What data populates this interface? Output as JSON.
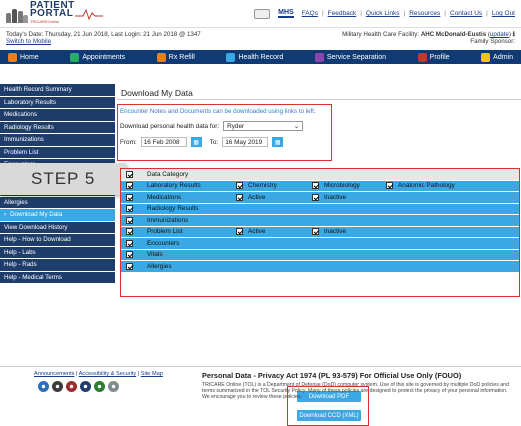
{
  "header": {
    "logo_line1": "PATIENT",
    "logo_line2": "PORTAL",
    "logo_sub": "TRICAREOnline",
    "mhs_label": "MHS",
    "links": [
      "FAQs",
      "Feedback",
      "Quick Links",
      "Resources",
      "Contact Us",
      "Log Out"
    ]
  },
  "info": {
    "date_text": "Today's Date: Thursday, 21 Jun 2018, Last Login: 21 Jun 2018 @ 1347",
    "mobile_link": "Switch to Mobile",
    "facility_label": "Military Health Care Facility: ",
    "facility_name": "AHC McDonald-Eustis",
    "update_link": "update",
    "sponsor_label": "Family Sponsor:"
  },
  "nav": {
    "items": [
      {
        "label": "Home",
        "icon": "home-icon",
        "color": "#e67e22"
      },
      {
        "label": "Appointments",
        "icon": "calendar-icon",
        "color": "#27ae60"
      },
      {
        "label": "Rx Refill",
        "icon": "pill-icon",
        "color": "#e67e22"
      },
      {
        "label": "Health Record",
        "icon": "health-record-icon",
        "color": "#3aa8e3"
      },
      {
        "label": "Service Separation",
        "icon": "service-separation-icon",
        "color": "#8e44ad"
      },
      {
        "label": "Profile",
        "icon": "profile-icon",
        "color": "#c0392b"
      },
      {
        "label": "Admin",
        "icon": "admin-icon",
        "color": "#f1c40f"
      }
    ]
  },
  "sidebar": {
    "items": [
      "Health Record Summary",
      "Laboratory Results",
      "Medications",
      "Radiology Results",
      "Immunizations",
      "Problem List",
      "Encounters",
      "Documents",
      "Vitals",
      "Allergies",
      "Download My Data",
      "View Download History",
      "Help - How to Download",
      "Help - Labs",
      "Help - Rads",
      "Help - Medical Terms"
    ],
    "active_index": 10
  },
  "step_label": "STEP 5",
  "main": {
    "title": "Download My Data",
    "note": "Encounter Notes and Documents can be downloaded using links to left.",
    "download_for_label": "Download personal health data for:",
    "download_for_value": "Ryder",
    "from_label": "From:",
    "from_value": "16 Feb 2008",
    "to_label": "To:",
    "to_value": "16 May 2019"
  },
  "categories": {
    "header": "Data Category",
    "rows": [
      {
        "label": "Laboratory Results",
        "subs": [
          "Chemistry",
          "Microbiology",
          "Anatomic Pathology"
        ]
      },
      {
        "label": "Medications",
        "subs": [
          "Active",
          "Inactive"
        ]
      },
      {
        "label": "Radiology Results",
        "subs": []
      },
      {
        "label": "Immunizations",
        "subs": []
      },
      {
        "label": "Problem List",
        "subs": [
          "Active",
          "Inactive"
        ]
      },
      {
        "label": "Encounters",
        "subs": []
      },
      {
        "label": "Vitals",
        "subs": []
      },
      {
        "label": "Allergies",
        "subs": []
      }
    ]
  },
  "buttons": {
    "pdf": "Download PDF",
    "ccd": "Download CCD (XML)"
  },
  "footer": {
    "links": [
      "Announcements",
      "Accessibility & Security",
      "Site Map"
    ],
    "title": "Personal Data - Privacy Act 1974 (PL 93-579)  For Official Use Only (FOUO)",
    "body": "TRICARE Online (TOL) is a Department of Defense (DoD) computer system. Use of this site is governed by multiple DoD policies and terms summarized in the TOL Security Policy. Many of these policies are designed to protect the privacy of your personal information. We encourage you to review these policies.",
    "seal_colors": [
      "#2c6fb5",
      "#3b3b3b",
      "#9b2c2c",
      "#1f3d6b",
      "#2e7d32",
      "#7f8c8d"
    ]
  }
}
